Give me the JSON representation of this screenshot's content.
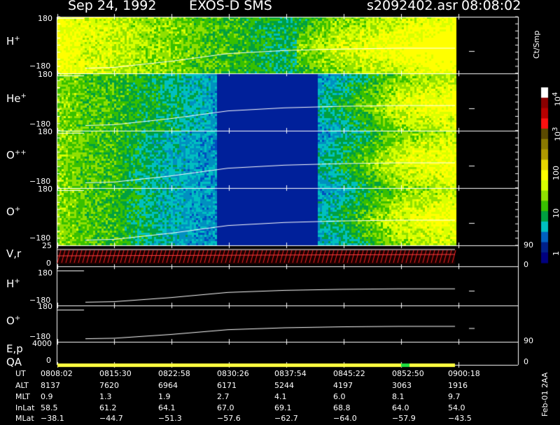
{
  "header": {
    "date": "Sep 24, 1992",
    "instrument": "EXOS-D SMS",
    "file": "s2092402.asr",
    "time": "08:08:02"
  },
  "panels": [
    {
      "label": "H",
      "charge": "+",
      "ytop": "180",
      "ybot": "−180"
    },
    {
      "label": "He",
      "charge": "+",
      "ytop": "180",
      "ybot": "−180"
    },
    {
      "label": "O",
      "charge": "++",
      "ytop": "180",
      "ybot": "−180"
    },
    {
      "label": "O",
      "charge": "+",
      "ytop": "180",
      "ybot": "−180"
    },
    {
      "label": "V,r",
      "charge": "",
      "ytop": "25",
      "ybot": "0"
    },
    {
      "label": "H",
      "charge": "+",
      "ytop": "180",
      "ybot": "−180"
    },
    {
      "label": "O",
      "charge": "+",
      "ytop": "180",
      "ybot": "−180"
    }
  ],
  "ep_panel": {
    "label1": "E,p",
    "label2": "QA",
    "ytop": "4000",
    "ybot": "0"
  },
  "right_axis": {
    "vr_top": "90",
    "vr_bot": "0",
    "ep_top": "90",
    "ep_bot": "0"
  },
  "colorbar": {
    "title": "Ct/Smp",
    "ticks": [
      "10",
      "10",
      "100",
      "10",
      "1"
    ],
    "tick_exps": [
      "4",
      "3",
      "",
      "",
      ""
    ],
    "colors": [
      "#ffffff",
      "#8b0000",
      "#b80000",
      "#ff1010",
      "#5b4a00",
      "#8a7a00",
      "#b09a00",
      "#e8d800",
      "#ffff00",
      "#d8ff00",
      "#90e000",
      "#38c000",
      "#00a040",
      "#00c0c0",
      "#0060c0",
      "#00208a",
      "#000080"
    ]
  },
  "footer_side": "Feb-01 2AA",
  "table": {
    "rows": [
      {
        "name": "UT",
        "values": [
          "0808:02",
          "0815:30",
          "0822:58",
          "0830:26",
          "0837:54",
          "0845:22",
          "0852:50",
          "0900:18"
        ]
      },
      {
        "name": "ALT",
        "values": [
          "8137",
          "7620",
          "6964",
          "6171",
          "5244",
          "4197",
          "3063",
          "1916"
        ]
      },
      {
        "name": "MLT",
        "values": [
          "0.9",
          "1.3",
          "1.9",
          "2.7",
          "4.1",
          "6.0",
          "8.1",
          "9.7"
        ]
      },
      {
        "name": "InLat",
        "values": [
          "58.5",
          "61.2",
          "64.1",
          "67.0",
          "69.1",
          "68.8",
          "64.0",
          "54.0"
        ]
      },
      {
        "name": "MLat",
        "values": [
          "−38.1",
          "−44.7",
          "−51.3",
          "−57.6",
          "−62.7",
          "−64.0",
          "−57.9",
          "−43.5"
        ]
      }
    ]
  },
  "chart_data": {
    "type": "heatmap",
    "title": "Sep 24, 1992   EXOS-D SMS",
    "x": [
      "0808:02",
      "0815:30",
      "0822:58",
      "0830:26",
      "0837:54",
      "0845:22",
      "0852:50",
      "0900:18"
    ],
    "ylim_angle": [
      -180,
      180
    ],
    "ylim_vr": [
      0,
      25
    ],
    "ylim_ep": [
      0,
      4000
    ],
    "series": [
      {
        "name": "H+",
        "intensity_profile": [
          8,
          7,
          6,
          5,
          4,
          6,
          7,
          8
        ]
      },
      {
        "name": "He+",
        "intensity_profile": [
          6,
          5,
          4,
          2,
          1,
          3,
          6,
          7
        ]
      },
      {
        "name": "O++",
        "intensity_profile": [
          6,
          5,
          3,
          2,
          1,
          3,
          6,
          7
        ]
      },
      {
        "name": "O+",
        "intensity_profile": [
          6,
          5,
          3,
          2,
          1,
          3,
          6,
          7
        ]
      }
    ],
    "pitch_trace": [
      -160,
      -150,
      -110,
      -60,
      -40,
      -30,
      -25,
      -25
    ],
    "colorbar_range": [
      1,
      10000
    ]
  }
}
